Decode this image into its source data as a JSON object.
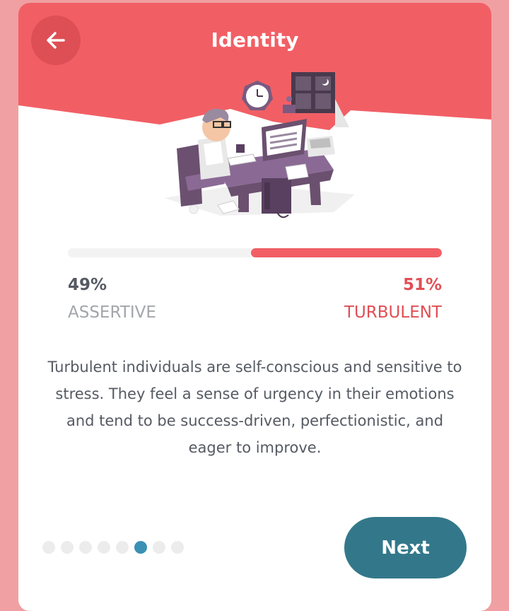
{
  "header": {
    "title": "Identity"
  },
  "trait": {
    "progress_fraction": 0.51,
    "left_percent": "49%",
    "right_percent": "51%",
    "left_label": "ASSERTIVE",
    "right_label": "TURBULENT",
    "description": "Turbulent individuals are self-conscious and sensitive to stress. They feel a sense of urgency in their emotions and tend to be success-driven, perfectionistic, and eager to improve."
  },
  "pagination": {
    "total": 8,
    "active_index": 5
  },
  "footer": {
    "next_label": "Next"
  },
  "colors": {
    "header_red": "#f15f65",
    "accent_red": "#e04f55",
    "teal": "#33788a",
    "active_dot": "#3a91b3",
    "background_pink": "#f0a0a2"
  }
}
